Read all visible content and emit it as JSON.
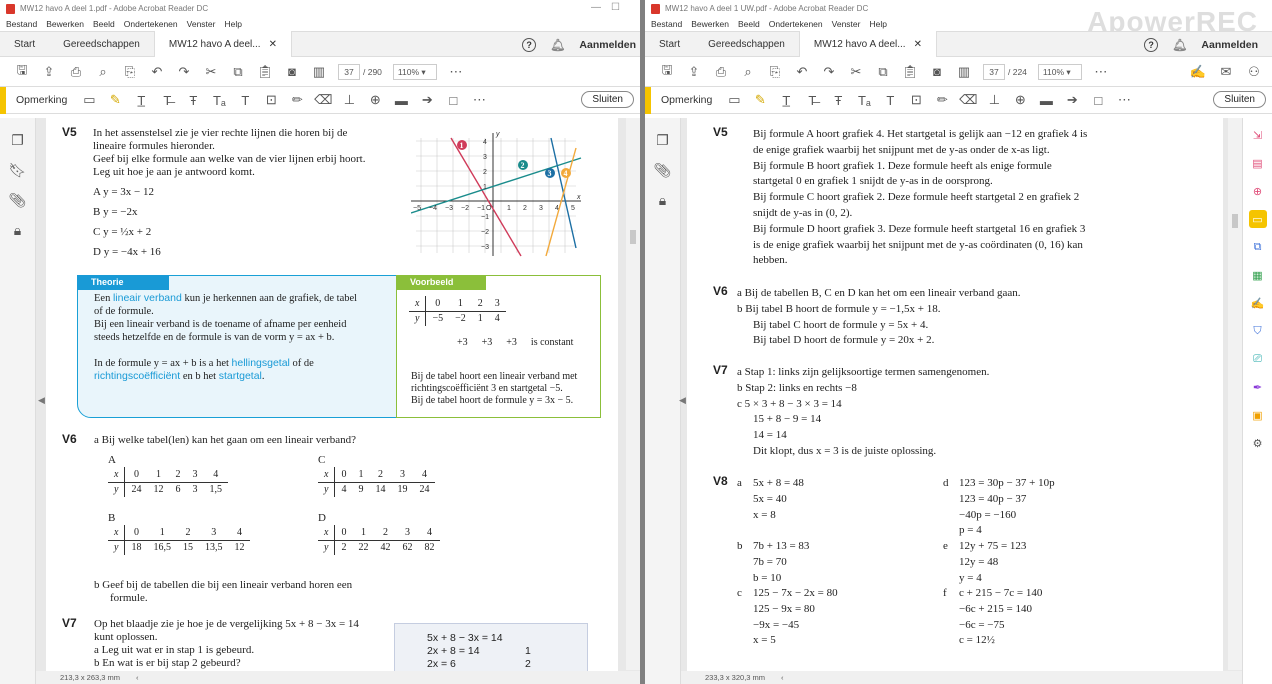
{
  "left": {
    "title": "MW12 havo A deel 1.pdf - Adobe Acrobat Reader DC",
    "menu": [
      "Bestand",
      "Bewerken",
      "Beeld",
      "Ondertekenen",
      "Venster",
      "Help"
    ],
    "tabs": {
      "start": "Start",
      "tools": "Gereedschappen",
      "doc": "MW12 havo A deel..."
    },
    "signin": "Aanmelden",
    "page_current": "37",
    "page_total": "/ 290",
    "zoom": "110%",
    "comment_label": "Opmerking",
    "close": "Sluiten",
    "status": "213,3 x 263,3 mm",
    "v5": {
      "num": "V5",
      "l1": "In het assenstelsel zie je vier rechte lijnen die horen bij de",
      "l2": "lineaire formules hieronder.",
      "l3": "Geef bij elke formule aan welke van de vier lijnen erbij hoort.",
      "l4": "Leg uit hoe je aan je antwoord komt.",
      "a": "A  y = 3x − 12",
      "b": "B  y = −2x",
      "c": "C  y = ½x + 2",
      "d": "D  y = −4x + 16"
    },
    "graph": {
      "xlabel": "x",
      "ylabel": "y",
      "xticks": [
        "−5",
        "−4",
        "−3",
        "−2",
        "−1",
        "O",
        "1",
        "2",
        "3",
        "4",
        "5"
      ],
      "yticks": [
        "4",
        "3",
        "2",
        "1",
        "−1",
        "−2",
        "−3"
      ],
      "markers": [
        "1",
        "2",
        "3",
        "4"
      ]
    },
    "theorie": {
      "label": "Theorie",
      "t1": "Een",
      "t1b": "lineair verband",
      "t1c": "kun je herkennen aan de grafiek, de tabel",
      "t2": "of de formule.",
      "t3": "Bij een lineair verband is de toename of afname per eenheid",
      "t4": "steeds hetzelfde en de formule is van de vorm y = ax + b.",
      "t5": "In de formule y = ax + b is a het",
      "t5b": "hellingsgetal",
      "t5c": "of de",
      "t6a": "richtingscoëfficiënt",
      "t6b": "en b het",
      "t6c": "startgetal",
      "t6d": "."
    },
    "voorbeeld": {
      "label": "Voorbeeld",
      "xrow": [
        "x",
        "0",
        "1",
        "2",
        "3"
      ],
      "yrow": [
        "y",
        "−5",
        "−2",
        "1",
        "4"
      ],
      "diffs": [
        "+3",
        "+3",
        "+3"
      ],
      "constant": "is constant",
      "p1": "Bij de tabel hoort een lineair verband met",
      "p2": "richtingscoëfficiënt 3 en startgetal −5.",
      "p3": "Bij de tabel hoort de formule y = 3x − 5."
    },
    "v6": {
      "num": "V6",
      "q": "a   Bij welke tabel(len) kan het gaan om een lineair verband?",
      "A": {
        "label": "A",
        "x": [
          "x",
          "0",
          "1",
          "2",
          "3",
          "4"
        ],
        "y": [
          "y",
          "24",
          "12",
          "6",
          "3",
          "1,5"
        ]
      },
      "B": {
        "label": "B",
        "x": [
          "x",
          "0",
          "1",
          "2",
          "3",
          "4"
        ],
        "y": [
          "y",
          "18",
          "16,5",
          "15",
          "13,5",
          "12"
        ]
      },
      "C": {
        "label": "C",
        "x": [
          "x",
          "0",
          "1",
          "2",
          "3",
          "4"
        ],
        "y": [
          "y",
          "4",
          "9",
          "14",
          "19",
          "24"
        ]
      },
      "D": {
        "label": "D",
        "x": [
          "x",
          "0",
          "1",
          "2",
          "3",
          "4"
        ],
        "y": [
          "y",
          "2",
          "22",
          "42",
          "62",
          "82"
        ]
      },
      "b1": "b   Geef bij de tabellen die bij een lineair verband horen een",
      "b2": "formule."
    },
    "v7": {
      "num": "V7",
      "l1": "Op het blaadje zie je hoe je de vergelijking 5x + 8 − 3x = 14",
      "l2": "kunt oplossen.",
      "a": "a   Leg uit wat er in stap 1 is gebeurd.",
      "b": "b   En wat is er bij stap 2 gebeurd?",
      "n1": "5x + 8 − 3x = 14",
      "n2": "2x + 8 = 14",
      "n3": "2x = 6",
      "s1": "1",
      "s2": "2"
    }
  },
  "right": {
    "title": "MW12 havo A deel 1 UW.pdf - Adobe Acrobat Reader DC",
    "menu": [
      "Bestand",
      "Bewerken",
      "Beeld",
      "Ondertekenen",
      "Venster",
      "Help"
    ],
    "tabs": {
      "start": "Start",
      "tools": "Gereedschappen",
      "doc": "MW12 havo A deel..."
    },
    "signin": "Aanmelden",
    "page_current": "37",
    "page_total": "/ 224",
    "zoom": "110%",
    "comment_label": "Opmerking",
    "close": "Sluiten",
    "status": "233,3 x 320,3 mm",
    "watermark": "ApowerREC",
    "v5": {
      "num": "V5",
      "lines": [
        "Bij formule A hoort grafiek 4. Het startgetal is gelijk aan −12 en grafiek 4 is",
        "de enige grafiek waarbij het snijpunt met de y-as onder de x-as ligt.",
        "Bij formule B hoort grafiek 1. Deze formule heeft als enige formule",
        "startgetal 0 en grafiek 1 snijdt de y-as in de oorsprong.",
        "Bij formule C hoort grafiek 2. Deze formule heeft startgetal 2 en grafiek 2",
        "snijdt de y-as in (0, 2).",
        "Bij formule D hoort grafiek 3. Deze formule heeft startgetal 16 en grafiek 3",
        "is de enige grafiek waarbij het snijpunt met de y-as coördinaten (0, 16) kan",
        "hebben."
      ]
    },
    "v6": {
      "num": "V6",
      "a": "a   Bij de tabellen B, C en D kan het om een lineair verband gaan.",
      "b": "b   Bij tabel B hoort de formule y = −1,5x + 18.",
      "l2": "Bij tabel C hoort de formule y = 5x + 4.",
      "l3": "Bij tabel D hoort de formule y = 20x + 2."
    },
    "v7": {
      "num": "V7",
      "a": "a   Stap 1: links zijn gelijksoortige termen samengenomen.",
      "b": "b   Stap 2: links en rechts −8",
      "c": "c   5 × 3 + 8 − 3 × 3 = 14",
      "c2": "15 + 8 − 9 = 14",
      "c3": "14 = 14",
      "c4": "Dit klopt, dus x = 3 is de juiste oplossing."
    },
    "v8": {
      "num": "V8",
      "a": [
        "a",
        "5x + 8 = 48",
        "5x = 40",
        "x = 8"
      ],
      "b": [
        "b",
        "7b + 13 = 83",
        "7b = 70",
        "b = 10"
      ],
      "c": [
        "c",
        "125 − 7x − 2x = 80",
        "125 − 9x = 80",
        "−9x = −45",
        "x = 5"
      ],
      "d": [
        "d",
        "123 = 30p − 37 + 10p",
        "123 = 40p − 37",
        "−40p = −160",
        "p = 4"
      ],
      "e": [
        "e",
        "12y + 75 = 123",
        "12y = 48",
        "y = 4"
      ],
      "f": [
        "f",
        "c + 215 − 7c = 140",
        "−6c + 215 = 140",
        "−6c = −75",
        "c = 12½"
      ]
    }
  }
}
